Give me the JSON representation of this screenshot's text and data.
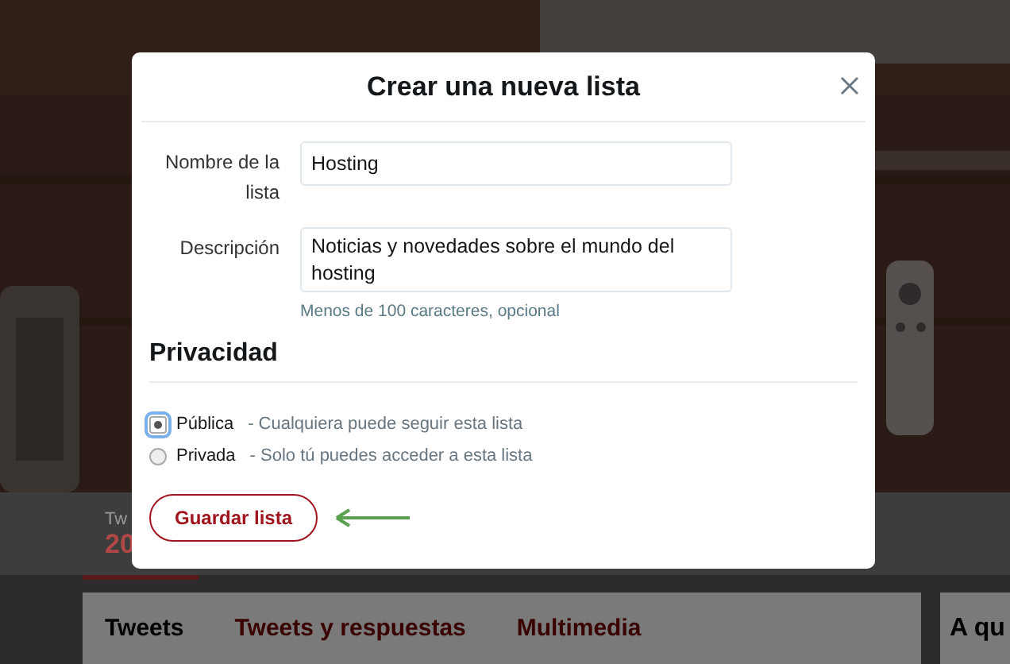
{
  "background": {
    "profile_stat": {
      "label": "Tw",
      "value": "20",
      "selected": true
    },
    "tabs": [
      {
        "label": "Tweets",
        "selected": true
      },
      {
        "label": "Tweets y respuestas",
        "selected": false
      },
      {
        "label": "Multimedia",
        "selected": false
      }
    ],
    "side_card": {
      "title": "A qu"
    }
  },
  "dialog": {
    "title": "Crear una nueva lista",
    "fields": [
      {
        "kind": "input",
        "label": "Nombre de la lista",
        "value": "Hosting"
      },
      {
        "kind": "textarea",
        "label": "Descripción",
        "value": "Noticias y novedades sobre el mundo del hosting",
        "hint": "Menos de 100 caracteres, opcional"
      }
    ],
    "privacy": {
      "heading": "Privacidad",
      "options": [
        {
          "label": "Pública",
          "description": "- Cualquiera puede seguir esta lista",
          "selected": true
        },
        {
          "label": "Privada",
          "description": "- Solo tú puedes acceder a esta lista",
          "selected": false
        }
      ]
    },
    "save_button": "Guardar lista"
  }
}
